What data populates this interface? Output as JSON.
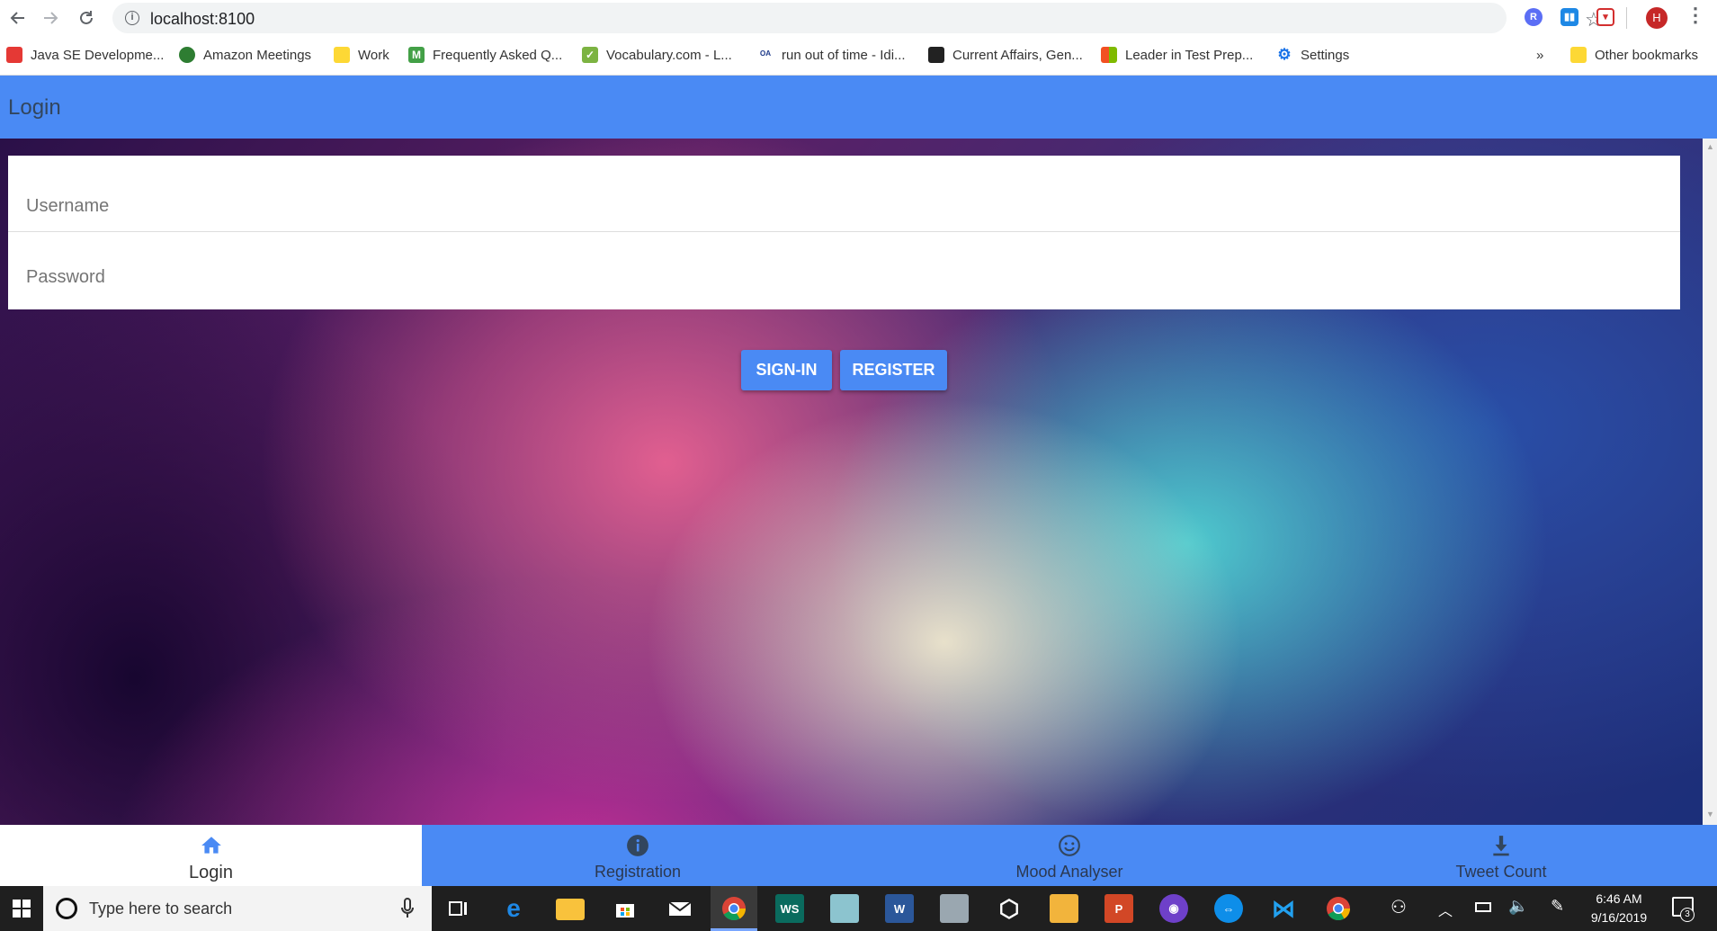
{
  "browser": {
    "url": "localhost:8100",
    "avatar_letter": "H",
    "bookmarks": [
      {
        "label": "Java SE Developme...",
        "icon": "oracle-icon",
        "color": "#e53935"
      },
      {
        "label": "Amazon Meetings",
        "icon": "chime-icon",
        "color": "#2e7d32"
      },
      {
        "label": "Work",
        "icon": "folder-icon",
        "color": "#fdd835"
      },
      {
        "label": "Frequently Asked Q...",
        "icon": "m-icon",
        "color": "#43a047"
      },
      {
        "label": "Vocabulary.com - L...",
        "icon": "check-icon",
        "color": "#7cb342"
      },
      {
        "label": "run out of time - Idi...",
        "icon": "idiom-icon",
        "color": "#1e3a8a"
      },
      {
        "label": "Current Affairs, Gen...",
        "icon": "ca-icon",
        "color": "#222222"
      },
      {
        "label": "Leader in Test Prep...",
        "icon": "microsoft-icon",
        "color": "#f25022"
      },
      {
        "label": "Settings",
        "icon": "gear-icon",
        "color": "#1a73e8"
      }
    ],
    "more_label": "»",
    "other_bookmarks": "Other bookmarks"
  },
  "app": {
    "title": "Login",
    "username_placeholder": "Username",
    "password_placeholder": "Password",
    "signin_label": "SIGN-IN",
    "register_label": "REGISTER"
  },
  "tabs": [
    {
      "label": "Login",
      "icon": "home-icon",
      "active": true
    },
    {
      "label": "Registration",
      "icon": "info-icon",
      "active": false
    },
    {
      "label": "Mood Analyser",
      "icon": "happy-face-icon",
      "active": false
    },
    {
      "label": "Tweet Count",
      "icon": "download-icon",
      "active": false
    }
  ],
  "taskbar": {
    "search_placeholder": "Type here to search",
    "time": "6:46 AM",
    "date": "9/16/2019",
    "notification_count": "3"
  },
  "colors": {
    "primary": "#4a8af4",
    "taskbar": "#1f1f1f"
  }
}
